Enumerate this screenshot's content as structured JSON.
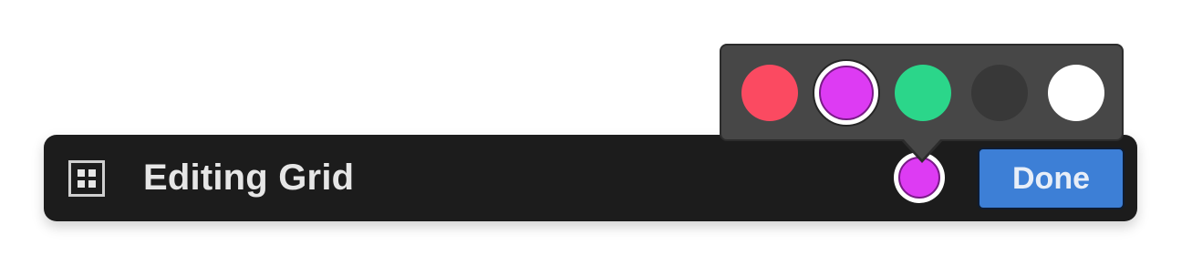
{
  "toolbar": {
    "title": "Editing Grid",
    "done_label": "Done",
    "icon": "grid-icon",
    "current_color": "#dd3bf3"
  },
  "color_picker": {
    "selected_index": 1,
    "colors": [
      "#fb4a61",
      "#dd3bf3",
      "#2bd68a",
      "#383838",
      "#ffffff"
    ]
  },
  "theme": {
    "toolbar_bg": "#1c1c1c",
    "popover_bg": "#474747",
    "done_bg": "#3d7fd6"
  }
}
